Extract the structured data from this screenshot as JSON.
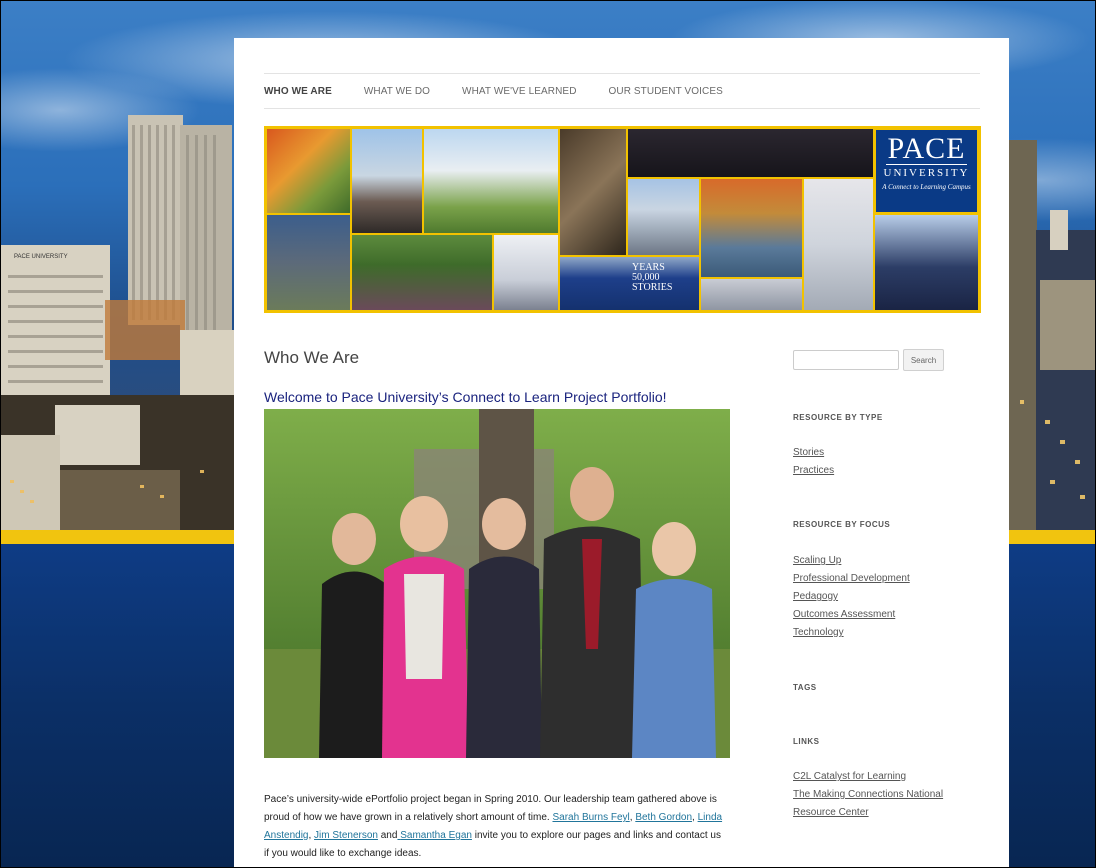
{
  "nav": {
    "items": [
      {
        "label": "WHO WE ARE",
        "current": true
      },
      {
        "label": "WHAT WE DO",
        "current": false
      },
      {
        "label": "WHAT WE'VE LEARNED",
        "current": false
      },
      {
        "label": "OUR STUDENT VOICES",
        "current": false
      }
    ]
  },
  "banner": {
    "logo_title": "PACE",
    "logo_subtitle": "UNIVERSITY",
    "logo_tagline": "A Connect to Learning Campus",
    "bus_line1": "YEARS",
    "bus_line2": "50,000",
    "bus_line3": "STORIES"
  },
  "background": {
    "building_sign": "PACE UNIVERSITY"
  },
  "main": {
    "page_title": "Who We Are",
    "welcome_heading": "Welcome to Pace University’s Connect to Learn Project Portfolio!",
    "intro_text_1": "Pace’s university-wide ePortfolio project began in Spring 2010.  Our leadership team gathered above is proud of how we have grown in a relatively short amount of time.  ",
    "people": [
      "Sarah Burns Feyl",
      "Beth Gordon",
      "Linda Anstendig",
      "Jim Stenerson",
      "Samantha Egan"
    ],
    "sep_1": ",",
    "sep_2": ", ",
    "sep_3": ", ",
    "sep_4": " and",
    "intro_text_2": " invite you to explore our pages and links and contact us if you would like to exchange ideas."
  },
  "sidebar": {
    "search_placeholder": "",
    "search_button": "Search",
    "resource_type_title": "RESOURCE BY TYPE",
    "resource_type_links": [
      "Stories",
      "Practices"
    ],
    "resource_focus_title": "RESOURCE BY FOCUS",
    "resource_focus_links": [
      "Scaling Up",
      "Professional Development",
      "Pedagogy",
      "Outcomes Assessment",
      "Technology"
    ],
    "tags_title": "TAGS",
    "links_title": "LINKS",
    "links": [
      "C2L Catalyst for Learning",
      "The Making Connections National Resource Center"
    ]
  },
  "colors": {
    "accent_yellow": "#f2c200",
    "navy": "#0b2f66",
    "heading_blue": "#1a237e",
    "link_blue": "#21759b"
  }
}
